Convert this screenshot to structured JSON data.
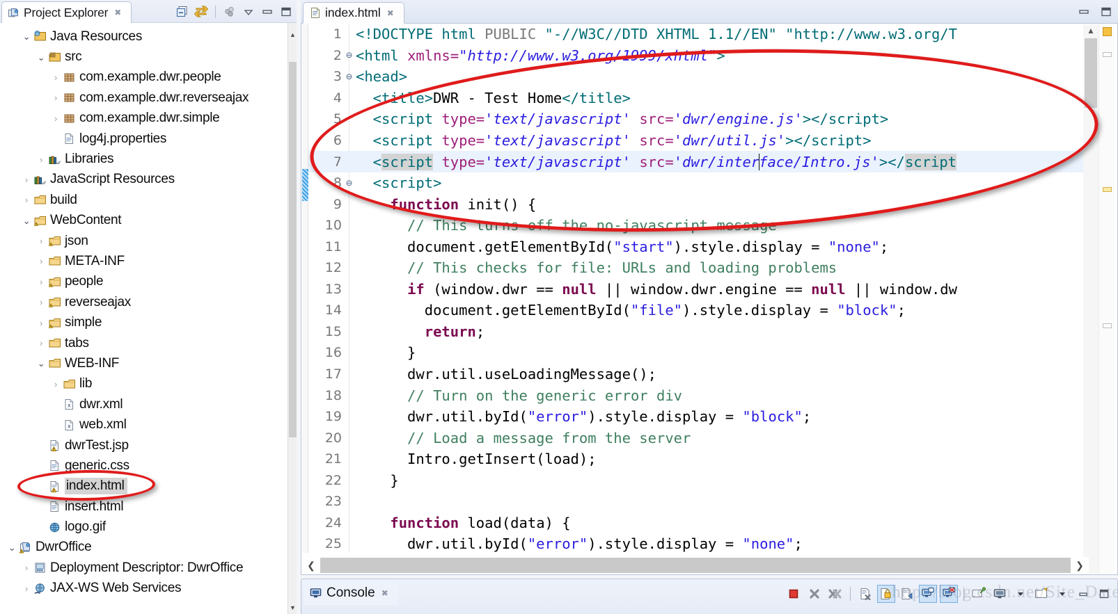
{
  "explorer": {
    "tab_title": "Project Explorer",
    "tab_close": "✖",
    "toolbar": [
      {
        "name": "collapse-all-icon",
        "title": "Collapse All"
      },
      {
        "name": "link-with-editor-icon",
        "title": "Link with Editor"
      },
      {
        "name": "view-menu-icon",
        "title": "View Menu"
      },
      {
        "name": "minimize-icon",
        "title": "Minimize"
      },
      {
        "name": "maximize-icon",
        "title": "Maximize"
      }
    ],
    "tree": [
      {
        "label": "Java Resources",
        "indent": 1,
        "state": "open",
        "icon": "java-resources-icon"
      },
      {
        "label": "src",
        "indent": 2,
        "state": "open",
        "icon": "source-folder-icon"
      },
      {
        "label": "com.example.dwr.people",
        "indent": 3,
        "state": "closed",
        "icon": "package-icon"
      },
      {
        "label": "com.example.dwr.reverseajax",
        "indent": 3,
        "state": "closed",
        "icon": "package-icon"
      },
      {
        "label": "com.example.dwr.simple",
        "indent": 3,
        "state": "closed",
        "icon": "package-icon"
      },
      {
        "label": "log4j.properties",
        "indent": 3,
        "state": "leaf",
        "icon": "file-icon"
      },
      {
        "label": "Libraries",
        "indent": 2,
        "state": "closed",
        "icon": "library-icon"
      },
      {
        "label": "JavaScript Resources",
        "indent": 1,
        "state": "closed",
        "icon": "library-icon"
      },
      {
        "label": "build",
        "indent": 1,
        "state": "closed",
        "icon": "folder-icon"
      },
      {
        "label": "WebContent",
        "indent": 1,
        "state": "open",
        "icon": "web-folder-icon"
      },
      {
        "label": "json",
        "indent": 2,
        "state": "closed",
        "icon": "web-folder-icon"
      },
      {
        "label": "META-INF",
        "indent": 2,
        "state": "closed",
        "icon": "folder-icon"
      },
      {
        "label": "people",
        "indent": 2,
        "state": "closed",
        "icon": "web-folder-icon"
      },
      {
        "label": "reverseajax",
        "indent": 2,
        "state": "closed",
        "icon": "web-folder-icon"
      },
      {
        "label": "simple",
        "indent": 2,
        "state": "closed",
        "icon": "web-folder-icon"
      },
      {
        "label": "tabs",
        "indent": 2,
        "state": "closed",
        "icon": "folder-icon"
      },
      {
        "label": "WEB-INF",
        "indent": 2,
        "state": "open",
        "icon": "folder-icon"
      },
      {
        "label": "lib",
        "indent": 3,
        "state": "closed",
        "icon": "folder-icon"
      },
      {
        "label": "dwr.xml",
        "indent": 3,
        "state": "leaf",
        "icon": "xml-file-icon"
      },
      {
        "label": "web.xml",
        "indent": 3,
        "state": "leaf",
        "icon": "xml-file-icon"
      },
      {
        "label": "dwrTest.jsp",
        "indent": 2,
        "state": "leaf",
        "icon": "warning-file-icon"
      },
      {
        "label": "generic.css",
        "indent": 2,
        "state": "leaf",
        "icon": "file-icon"
      },
      {
        "label": "index.html",
        "indent": 2,
        "state": "leaf",
        "icon": "warning-file-icon",
        "selected": true
      },
      {
        "label": "insert.html",
        "indent": 2,
        "state": "leaf",
        "icon": "file-icon"
      },
      {
        "label": "logo.gif",
        "indent": 2,
        "state": "leaf",
        "icon": "image-file-icon"
      },
      {
        "label": "DwrOffice",
        "indent": 0,
        "state": "open",
        "icon": "project-warning-icon"
      },
      {
        "label": "Deployment Descriptor: DwrOffice",
        "indent": 1,
        "state": "closed",
        "icon": "deployment-descriptor-icon"
      },
      {
        "label": "JAX-WS Web Services",
        "indent": 1,
        "state": "closed",
        "icon": "web-services-icon"
      }
    ]
  },
  "editor": {
    "tab_title": "index.html",
    "tab_close": "✖",
    "toolbar": [
      {
        "name": "minimize-icon"
      },
      {
        "name": "maximize-icon"
      }
    ],
    "lines": [
      {
        "num": "1",
        "fold": "",
        "highlight": false,
        "tokens": [
          {
            "t": "&lt;!DOCTYPE ",
            "c": "t-tag"
          },
          {
            "t": "html ",
            "c": "t-dtd"
          },
          {
            "t": "PUBLIC ",
            "c": "t-gray"
          },
          {
            "t": "\"-//W3C//DTD XHTML 1.1//EN\" ",
            "c": "t-dtd"
          },
          {
            "t": "\"http://www.w3.org/T",
            "c": "t-dtd"
          }
        ]
      },
      {
        "num": "2",
        "fold": "⊖",
        "highlight": false,
        "tokens": [
          {
            "t": "&lt;html ",
            "c": "t-tag"
          },
          {
            "t": "xmlns=",
            "c": "t-attr"
          },
          {
            "t": "\"http://www.w3.org/1999/xhtml\"",
            "c": "t-str"
          },
          {
            "t": "&gt;",
            "c": "t-tag"
          }
        ]
      },
      {
        "num": "3",
        "fold": "⊖",
        "highlight": false,
        "tokens": [
          {
            "t": "&lt;head&gt;",
            "c": "t-tag"
          }
        ]
      },
      {
        "num": "4",
        "fold": "",
        "highlight": false,
        "tokens": [
          {
            "t": "  &lt;title&gt;",
            "c": "t-tag"
          },
          {
            "t": "DWR - Test Home",
            "c": "t-plain"
          },
          {
            "t": "&lt;/title&gt;",
            "c": "t-tag"
          }
        ]
      },
      {
        "num": "5",
        "fold": "",
        "highlight": false,
        "tokens": [
          {
            "t": "  &lt;script ",
            "c": "t-tag"
          },
          {
            "t": "type=",
            "c": "t-attr"
          },
          {
            "t": "'text/javascript'",
            "c": "t-str"
          },
          {
            "t": " ",
            "c": "t-plain"
          },
          {
            "t": "src=",
            "c": "t-attr"
          },
          {
            "t": "'dwr/engine.js'",
            "c": "t-str"
          },
          {
            "t": "&gt;&lt;/script&gt;",
            "c": "t-tag"
          }
        ]
      },
      {
        "num": "6",
        "fold": "",
        "highlight": false,
        "tokens": [
          {
            "t": "  &lt;script ",
            "c": "t-tag"
          },
          {
            "t": "type=",
            "c": "t-attr"
          },
          {
            "t": "'text/javascript'",
            "c": "t-str"
          },
          {
            "t": " ",
            "c": "t-plain"
          },
          {
            "t": "src=",
            "c": "t-attr"
          },
          {
            "t": "'dwr/util.js'",
            "c": "t-str"
          },
          {
            "t": "&gt;&lt;/script&gt;",
            "c": "t-tag"
          }
        ]
      },
      {
        "num": "7",
        "fold": "",
        "highlight": true,
        "tokens": [
          {
            "t": "  &lt;",
            "c": "t-tag"
          },
          {
            "t": "script",
            "c": "t-tag occ"
          },
          {
            "t": " ",
            "c": "t-plain"
          },
          {
            "t": "type=",
            "c": "t-attr"
          },
          {
            "t": "'text/javascript'",
            "c": "t-str"
          },
          {
            "t": " ",
            "c": "t-plain"
          },
          {
            "t": "src=",
            "c": "t-attr"
          },
          {
            "t": "'dwr/inter",
            "c": "t-str"
          },
          {
            "t": "CARET",
            "c": "caret"
          },
          {
            "t": "face/Intro.js'",
            "c": "t-str"
          },
          {
            "t": "&gt;&lt;/",
            "c": "t-tag"
          },
          {
            "t": "script",
            "c": "t-tag occ"
          }
        ]
      },
      {
        "num": "8",
        "fold": "⊖",
        "highlight": false,
        "tokens": [
          {
            "t": "  &lt;script&gt;",
            "c": "t-tag"
          }
        ]
      },
      {
        "num": "9",
        "fold": "",
        "highlight": false,
        "tokens": [
          {
            "t": "    ",
            "c": "t-plain"
          },
          {
            "t": "function",
            "c": "t-kw"
          },
          {
            "t": " init() {",
            "c": "t-plain"
          }
        ]
      },
      {
        "num": "10",
        "fold": "",
        "highlight": false,
        "tokens": [
          {
            "t": "      // This turns off the no-javascript message",
            "c": "t-cmt"
          }
        ]
      },
      {
        "num": "11",
        "fold": "",
        "highlight": false,
        "tokens": [
          {
            "t": "      document.getElementById(",
            "c": "t-plain"
          },
          {
            "t": "\"start\"",
            "c": "t-jstr"
          },
          {
            "t": ").style.display = ",
            "c": "t-plain"
          },
          {
            "t": "\"none\"",
            "c": "t-jstr"
          },
          {
            "t": ";",
            "c": "t-plain"
          }
        ]
      },
      {
        "num": "12",
        "fold": "",
        "highlight": false,
        "tokens": [
          {
            "t": "      // This checks for file: URLs and loading problems",
            "c": "t-cmt"
          }
        ]
      },
      {
        "num": "13",
        "fold": "",
        "highlight": false,
        "tokens": [
          {
            "t": "      ",
            "c": "t-plain"
          },
          {
            "t": "if",
            "c": "t-kw"
          },
          {
            "t": " (window.dwr == ",
            "c": "t-plain"
          },
          {
            "t": "null",
            "c": "t-kw"
          },
          {
            "t": " || window.dwr.engine == ",
            "c": "t-plain"
          },
          {
            "t": "null",
            "c": "t-kw"
          },
          {
            "t": " || window.dw",
            "c": "t-plain"
          }
        ]
      },
      {
        "num": "14",
        "fold": "",
        "highlight": false,
        "tokens": [
          {
            "t": "        document.getElementById(",
            "c": "t-plain"
          },
          {
            "t": "\"file\"",
            "c": "t-jstr"
          },
          {
            "t": ").style.display = ",
            "c": "t-plain"
          },
          {
            "t": "\"block\"",
            "c": "t-jstr"
          },
          {
            "t": ";",
            "c": "t-plain"
          }
        ]
      },
      {
        "num": "15",
        "fold": "",
        "highlight": false,
        "tokens": [
          {
            "t": "        ",
            "c": "t-plain"
          },
          {
            "t": "return",
            "c": "t-kw"
          },
          {
            "t": ";",
            "c": "t-plain"
          }
        ]
      },
      {
        "num": "16",
        "fold": "",
        "highlight": false,
        "tokens": [
          {
            "t": "      }",
            "c": "t-plain"
          }
        ]
      },
      {
        "num": "17",
        "fold": "",
        "highlight": false,
        "tokens": [
          {
            "t": "      dwr.util.useLoadingMessage();",
            "c": "t-plain"
          }
        ]
      },
      {
        "num": "18",
        "fold": "",
        "highlight": false,
        "tokens": [
          {
            "t": "      // Turn on the generic error div",
            "c": "t-cmt"
          }
        ]
      },
      {
        "num": "19",
        "fold": "",
        "highlight": false,
        "tokens": [
          {
            "t": "      dwr.util.byId(",
            "c": "t-plain"
          },
          {
            "t": "\"error\"",
            "c": "t-jstr"
          },
          {
            "t": ").style.display = ",
            "c": "t-plain"
          },
          {
            "t": "\"block\"",
            "c": "t-jstr"
          },
          {
            "t": ";",
            "c": "t-plain"
          }
        ]
      },
      {
        "num": "20",
        "fold": "",
        "highlight": false,
        "tokens": [
          {
            "t": "      // Load a message from the server",
            "c": "t-cmt"
          }
        ]
      },
      {
        "num": "21",
        "fold": "",
        "highlight": false,
        "tokens": [
          {
            "t": "      Intro.getInsert(load);",
            "c": "t-plain"
          }
        ]
      },
      {
        "num": "22",
        "fold": "",
        "highlight": false,
        "tokens": [
          {
            "t": "    }",
            "c": "t-plain"
          }
        ]
      },
      {
        "num": "23",
        "fold": "",
        "highlight": false,
        "tokens": [
          {
            "t": "",
            "c": "t-plain"
          }
        ]
      },
      {
        "num": "24",
        "fold": "",
        "highlight": false,
        "tokens": [
          {
            "t": "    ",
            "c": "t-plain"
          },
          {
            "t": "function",
            "c": "t-kw"
          },
          {
            "t": " load(data) {",
            "c": "t-plain"
          }
        ]
      },
      {
        "num": "25",
        "fold": "",
        "highlight": false,
        "tokens": [
          {
            "t": "      dwr.util.byId(",
            "c": "t-plain"
          },
          {
            "t": "\"error\"",
            "c": "t-jstr"
          },
          {
            "t": ").style.display = ",
            "c": "t-plain"
          },
          {
            "t": "\"none\"",
            "c": "t-jstr"
          },
          {
            "t": ";",
            "c": "t-plain"
          }
        ]
      }
    ],
    "hscroll_left_arrow": "❮",
    "hscroll_right_arrow": "❯"
  },
  "console": {
    "tab_title": "Console",
    "tab_close": "✖",
    "toolbar": [
      {
        "name": "terminate-icon",
        "active": false
      },
      {
        "name": "remove-launch-icon",
        "active": false
      },
      {
        "name": "remove-all-terminated-icon",
        "active": false
      },
      {
        "name": "clear-console-icon",
        "active": false
      },
      {
        "name": "scroll-lock-icon",
        "active": true
      },
      {
        "name": "word-wrap-icon",
        "active": false
      },
      {
        "name": "show-console-on-output-icon",
        "active": true
      },
      {
        "name": "show-console-on-error-icon",
        "active": true
      },
      {
        "name": "pin-console-icon",
        "active": false
      },
      {
        "name": "display-selected-console-icon",
        "active": false
      },
      {
        "name": "display-console-dropdown-icon",
        "active": false
      },
      {
        "name": "open-console-icon",
        "active": false
      },
      {
        "name": "open-console-dropdown-icon",
        "active": false
      },
      {
        "name": "minimize-icon",
        "active": false
      },
      {
        "name": "maximize-icon",
        "active": false
      }
    ]
  },
  "watermark": {
    "text": "http://blog.csdn.net/Site_Date"
  },
  "annotations": [
    {
      "name": "code-region-highlight",
      "color": "#e01b1b"
    },
    {
      "name": "index-html-file-highlight",
      "color": "#e01b1b"
    }
  ]
}
